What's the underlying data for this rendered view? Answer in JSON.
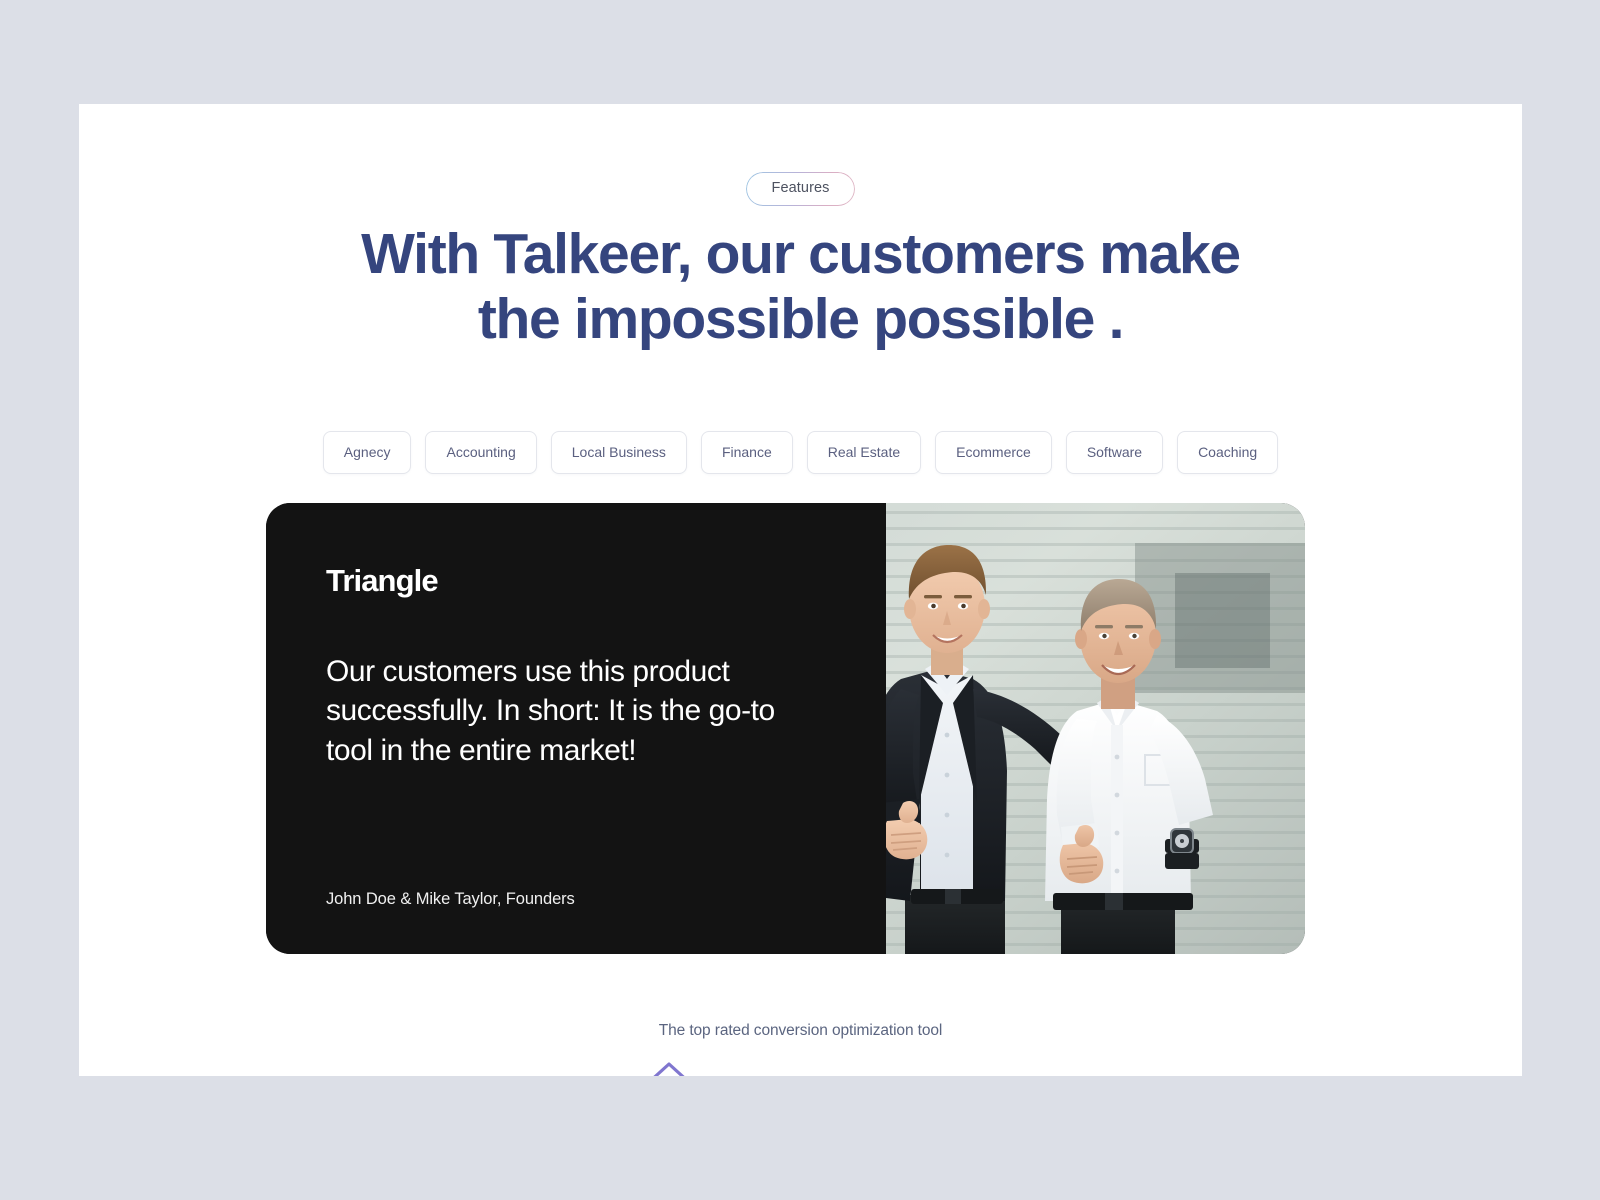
{
  "page": {
    "background_color": "#dcdfe7",
    "panel_color": "#ffffff"
  },
  "badge": {
    "label": "Features"
  },
  "heading": {
    "line1": "With Talkeer, our customers make",
    "line2": "the impossible possible .",
    "color": "#35457e"
  },
  "tabs": [
    {
      "label": "Agnecy"
    },
    {
      "label": "Accounting"
    },
    {
      "label": "Local Business"
    },
    {
      "label": "Finance"
    },
    {
      "label": "Real Estate"
    },
    {
      "label": "Ecommerce"
    },
    {
      "label": "Software"
    },
    {
      "label": "Coaching"
    }
  ],
  "testimonial": {
    "logo": "Triangle",
    "quote": "Our customers use this product successfully. In short: It is the go-to tool in the entire market!",
    "attribution": "John Doe & Mike Taylor, Founders",
    "card_background": "#131313",
    "photo_alt": "two-businessmen-thumbs-up-photo"
  },
  "footer": {
    "tagline": "The top rated conversion optimization tool"
  }
}
